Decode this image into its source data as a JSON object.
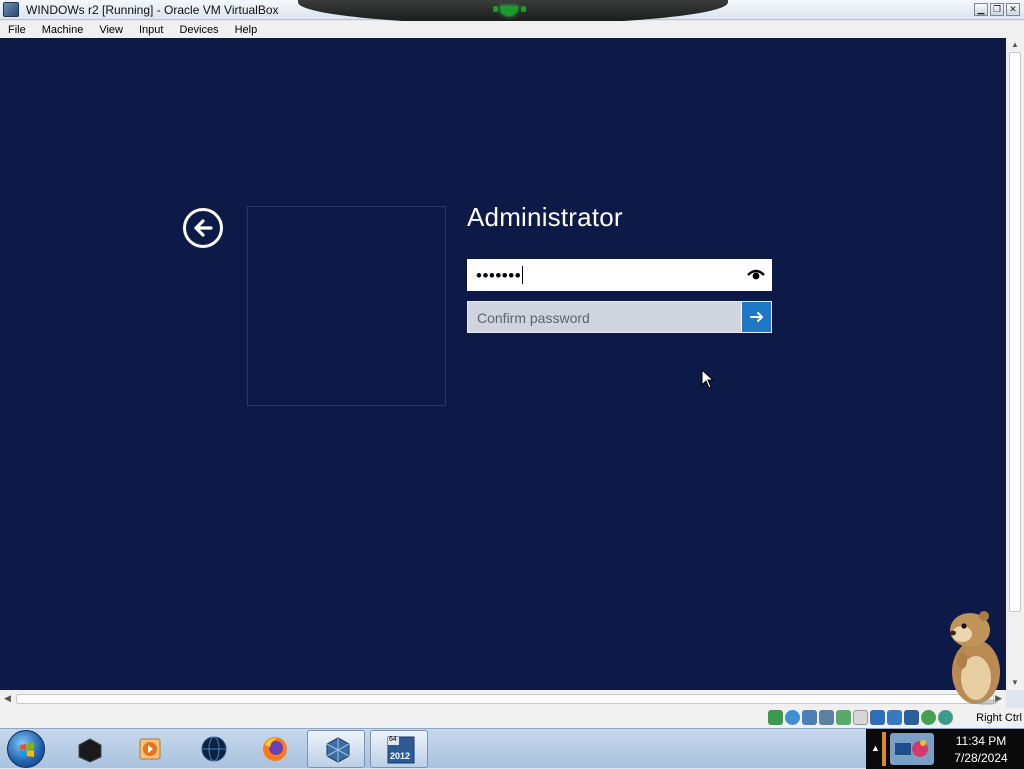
{
  "window": {
    "title": "WINDOWs r2 [Running] - Oracle VM VirtualBox",
    "buttons": [
      "minimize",
      "restore",
      "close"
    ]
  },
  "menubar": {
    "items": [
      "File",
      "Machine",
      "View",
      "Input",
      "Devices",
      "Help"
    ]
  },
  "guest": {
    "background": "#0d1a48",
    "username": "Administrator",
    "password_masked": "•••••••",
    "confirm_placeholder": "Confirm password",
    "accent": "#1f77c8",
    "icons": {
      "back": "back-arrow-circle-icon",
      "reveal": "eye-icon",
      "submit": "arrow-right-icon"
    }
  },
  "statusbar": {
    "host_key": "Right Ctrl",
    "icons": [
      "hard-disk-icon",
      "optical-drive-icon",
      "audio-icon",
      "network-icon",
      "usb-icon",
      "shared-folders-icon",
      "display-icon",
      "video-capture-icon",
      "virtualization-icon",
      "mouse-integration-icon",
      "keyboard-icon"
    ]
  },
  "taskbar": {
    "apps": [
      "black-box-app-icon",
      "media-player-icon",
      "globe-icon",
      "firefox-icon",
      "virtualbox-icon",
      "windows-server-2012-icon"
    ],
    "server_badge_top": "64",
    "server_badge_bottom": "2012",
    "clock_time": "11:34 PM",
    "clock_date": "7/28/2024"
  }
}
